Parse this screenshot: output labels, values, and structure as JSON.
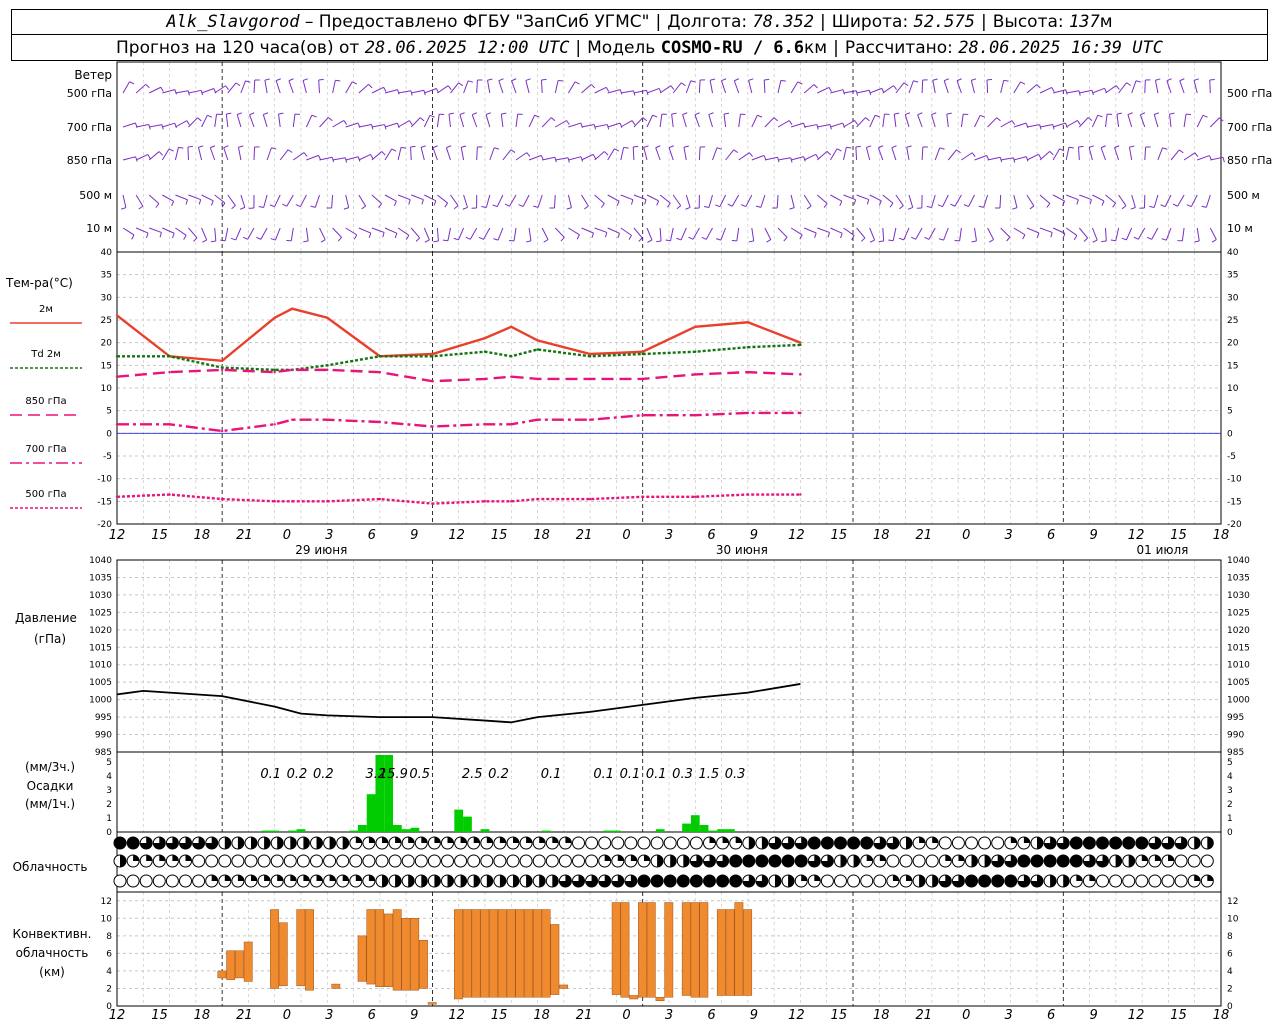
{
  "header": {
    "station": "Alk_Slavgorod",
    "provider_label": "– Предоставлено ФГБУ \"ЗапСиб УГМС\"",
    "lon_label": "Долгота:",
    "lon": "78.352",
    "lat_label": "Широта:",
    "lat": "52.575",
    "alt_label": "Высота:",
    "alt": "137",
    "alt_unit": "м",
    "forecast_label": "Прогноз на 120 часа(ов) от",
    "forecast_start": "28.06.2025 12:00 UTC",
    "model_label": "Модель",
    "model": "COSMO-RU / 6.6",
    "model_unit": "км",
    "computed_label": "Рассчитано:",
    "computed": "28.06.2025 16:39 UTC"
  },
  "panels": {
    "wind": {
      "title": "Ветер",
      "levels": [
        "500 гПа",
        "700 гПа",
        "850 гПа",
        "500 м",
        "10 м"
      ],
      "color": "#7b2fc4"
    },
    "temperature": {
      "title": "Тем-ра(°C)",
      "legend": [
        {
          "label": "2м",
          "color": "#e8402c",
          "style": "solid"
        },
        {
          "label": "Td 2м",
          "color": "#127512",
          "style": "dotted"
        },
        {
          "label": "850 гПа",
          "color": "#e8147c",
          "style": "dashed"
        },
        {
          "label": "700 гПа",
          "color": "#e8147c",
          "style": "dashdot"
        },
        {
          "label": "500 гПа",
          "color": "#e8147c",
          "style": "dotted"
        }
      ],
      "yticks": [
        "40",
        "35",
        "30",
        "25",
        "20",
        "15",
        "10",
        "5",
        "0",
        "-5",
        "-10",
        "-15",
        "-20"
      ]
    },
    "pressure": {
      "title": "Давление",
      "unit": "(гПа)",
      "yticks": [
        "1040",
        "1035",
        "1030",
        "1025",
        "1020",
        "1015",
        "1010",
        "1005",
        "1000",
        "995",
        "990",
        "985"
      ]
    },
    "precip": {
      "unit_top": "(мм/3ч.)",
      "title": "Осадки",
      "unit_bottom": "(мм/1ч.)",
      "yticks": [
        "5",
        "4",
        "3",
        "2",
        "1",
        "0"
      ],
      "color": "#00cc00"
    },
    "clouds": {
      "title": "Облачность"
    },
    "convective": {
      "title_lines": [
        "Конвективн.",
        "облачность",
        "(км)"
      ],
      "yticks": [
        "12",
        "10",
        "8",
        "6",
        "4",
        "2",
        "0"
      ],
      "color": "#ef8a2e"
    }
  },
  "time_axis": {
    "hour_labels": [
      "12",
      "15",
      "18",
      "21",
      "0",
      "3",
      "6",
      "9",
      "12",
      "15",
      "18",
      "21",
      "0",
      "3",
      "6",
      "9",
      "12",
      "15",
      "18",
      "21",
      "0",
      "3",
      "6",
      "9",
      "12",
      "15",
      "18"
    ],
    "date_labels": [
      "29 июня",
      "30 июня",
      "01 июля"
    ]
  },
  "chart_data": [
    {
      "type": "line",
      "title": "Тем-ра(°C)",
      "x": [
        "28.06 12",
        "28.06 18",
        "29.06 00",
        "29.06 06",
        "29.06 08",
        "29.06 12",
        "29.06 18",
        "30.06 00",
        "30.06 06",
        "30.06 09",
        "30.06 12",
        "30.06 18",
        "01.07 00",
        "01.07 06",
        "01.07 12",
        "01.07 18"
      ],
      "series": [
        {
          "name": "2м",
          "values": [
            26,
            17,
            16,
            25.5,
            27.5,
            25.5,
            17,
            17.5,
            21,
            23.5,
            20.5,
            17.5,
            18,
            23.5,
            24.5,
            20
          ]
        },
        {
          "name": "Td 2м",
          "values": [
            17,
            17,
            14.5,
            14,
            14,
            15,
            17,
            17,
            18,
            17,
            18.5,
            17,
            17.5,
            18,
            19,
            19.5
          ]
        },
        {
          "name": "850 гПа",
          "values": [
            12.5,
            13.5,
            14,
            13.5,
            14,
            14,
            13.5,
            11.5,
            12,
            12.5,
            12,
            12,
            12,
            13,
            13.5,
            13
          ]
        },
        {
          "name": "700 гПа",
          "values": [
            2,
            2,
            0.5,
            2,
            3,
            3,
            2.5,
            1.5,
            2,
            2,
            3,
            3,
            4,
            4,
            4.5,
            4.5
          ]
        },
        {
          "name": "500 гПа",
          "values": [
            -14,
            -13.5,
            -14.5,
            -15,
            -15,
            -15,
            -14.5,
            -15.5,
            -15,
            -15,
            -14.5,
            -14.5,
            -14,
            -14,
            -13.5,
            -13.5
          ]
        }
      ],
      "ylim": [
        -20,
        40
      ]
    },
    {
      "type": "line",
      "title": "Давление",
      "ylabel": "(гПа)",
      "x": [
        "28.06 12",
        "28.06 15",
        "28.06 18",
        "29.06 00",
        "29.06 06",
        "29.06 09",
        "29.06 12",
        "29.06 18",
        "30.06 00",
        "30.06 06",
        "30.06 09",
        "30.06 12",
        "30.06 18",
        "01.07 00",
        "01.07 06",
        "01.07 12",
        "01.07 18"
      ],
      "series": [
        {
          "name": "",
          "values": [
            1001.5,
            1002.5,
            1002,
            1001,
            998,
            996,
            995.5,
            995,
            995,
            994,
            993.5,
            995,
            996.5,
            998.5,
            1000.5,
            1002,
            1004.5
          ]
        }
      ],
      "ylim": [
        985,
        1040
      ]
    },
    {
      "type": "bar",
      "title": "Осадки",
      "unit": "мм/1ч.",
      "bars": [
        {
          "t": "29.06 05",
          "v": 0.1
        },
        {
          "t": "29.06 06",
          "v": 0.1
        },
        {
          "t": "29.06 08",
          "v": 0.1
        },
        {
          "t": "29.06 09",
          "v": 0.2
        },
        {
          "t": "29.06 15",
          "v": 0.1
        },
        {
          "t": "29.06 16",
          "v": 0.5
        },
        {
          "t": "29.06 17",
          "v": 2.7
        },
        {
          "t": "29.06 18",
          "v": 5.5
        },
        {
          "t": "29.06 19",
          "v": 5.5
        },
        {
          "t": "29.06 20",
          "v": 0.5
        },
        {
          "t": "29.06 21",
          "v": 0.2
        },
        {
          "t": "29.06 22",
          "v": 0.3
        },
        {
          "t": "30.06 03",
          "v": 1.6
        },
        {
          "t": "30.06 04",
          "v": 1.1
        },
        {
          "t": "30.06 06",
          "v": 0.2
        },
        {
          "t": "30.06 13",
          "v": 0.1
        },
        {
          "t": "30.06 20",
          "v": 0.1
        },
        {
          "t": "30.06 21",
          "v": 0.1
        },
        {
          "t": "01.07 02",
          "v": 0.2
        },
        {
          "t": "01.07 05",
          "v": 0.6
        },
        {
          "t": "01.07 06",
          "v": 1.2
        },
        {
          "t": "01.07 07",
          "v": 0.5
        },
        {
          "t": "01.07 08",
          "v": 0.1
        },
        {
          "t": "01.07 09",
          "v": 0.2
        },
        {
          "t": "01.07 10",
          "v": 0.2
        }
      ],
      "labels_3h": [
        {
          "t": "29.06 06",
          "text": "0.1"
        },
        {
          "t": "29.06 09",
          "text": "0.2"
        },
        {
          "t": "29.06 12",
          "text": "0.2"
        },
        {
          "t": "29.06 18",
          "text": "3.2"
        },
        {
          "t": "29.06 20",
          "text": "15.9"
        },
        {
          "t": "29.06 23",
          "text": "0.5"
        },
        {
          "t": "30.06 05",
          "text": "2.5"
        },
        {
          "t": "30.06 08",
          "text": "0.2"
        },
        {
          "t": "30.06 14",
          "text": "0.1"
        },
        {
          "t": "30.06 20",
          "text": "0.1"
        },
        {
          "t": "30.06 23",
          "text": "0.1"
        },
        {
          "t": "01.07 02",
          "text": "0.1"
        },
        {
          "t": "01.07 05",
          "text": "0.3"
        },
        {
          "t": "01.07 08",
          "text": "1.5"
        },
        {
          "t": "01.07 11",
          "text": "0.3"
        }
      ],
      "ylim": [
        0,
        5
      ]
    },
    {
      "type": "bar",
      "title": "Конвективн. облачность (км)",
      "ylim": [
        0,
        12
      ],
      "bars": [
        {
          "t": "29.06 00",
          "base": 3.2,
          "top": 4.0
        },
        {
          "t": "29.06 01",
          "base": 3.0,
          "top": 6.3
        },
        {
          "t": "29.06 02",
          "base": 3.2,
          "top": 6.3
        },
        {
          "t": "29.06 03",
          "base": 2.8,
          "top": 7.3
        },
        {
          "t": "29.06 06",
          "base": 2.0,
          "top": 11.0
        },
        {
          "t": "29.06 07",
          "base": 2.3,
          "top": 9.5
        },
        {
          "t": "29.06 09",
          "base": 2.3,
          "top": 11.0
        },
        {
          "t": "29.06 10",
          "base": 1.8,
          "top": 11.0
        },
        {
          "t": "29.06 13",
          "base": 2.0,
          "top": 2.5
        },
        {
          "t": "29.06 16",
          "base": 2.8,
          "top": 8.0
        },
        {
          "t": "29.06 17",
          "base": 2.5,
          "top": 11.0
        },
        {
          "t": "29.06 18",
          "base": 2.2,
          "top": 11.0
        },
        {
          "t": "29.06 19",
          "base": 2.2,
          "top": 10.5
        },
        {
          "t": "29.06 20",
          "base": 1.8,
          "top": 11.0
        },
        {
          "t": "29.06 21",
          "base": 1.8,
          "top": 10.0
        },
        {
          "t": "29.06 22",
          "base": 1.8,
          "top": 10.0
        },
        {
          "t": "29.06 23",
          "base": 2.0,
          "top": 7.5
        },
        {
          "t": "30.06 00",
          "base": 0.2,
          "top": 0.4
        },
        {
          "t": "30.06 03",
          "base": 0.8,
          "top": 11.0
        },
        {
          "t": "30.06 04",
          "base": 1.0,
          "top": 11.0
        },
        {
          "t": "30.06 05",
          "base": 1.0,
          "top": 11.0
        },
        {
          "t": "30.06 06",
          "base": 1.0,
          "top": 11.0
        },
        {
          "t": "30.06 07",
          "base": 1.0,
          "top": 11.0
        },
        {
          "t": "30.06 08",
          "base": 1.0,
          "top": 11.0
        },
        {
          "t": "30.06 09",
          "base": 1.0,
          "top": 11.0
        },
        {
          "t": "30.06 10",
          "base": 1.0,
          "top": 11.0
        },
        {
          "t": "30.06 11",
          "base": 1.0,
          "top": 11.0
        },
        {
          "t": "30.06 12",
          "base": 1.0,
          "top": 11.0
        },
        {
          "t": "30.06 13",
          "base": 1.0,
          "top": 11.0
        },
        {
          "t": "30.06 14",
          "base": 1.3,
          "top": 9.3
        },
        {
          "t": "30.06 15",
          "base": 2.0,
          "top": 2.4
        },
        {
          "t": "30.06 21",
          "base": 1.3,
          "top": 11.8
        },
        {
          "t": "30.06 22",
          "base": 1.0,
          "top": 11.8
        },
        {
          "t": "30.06 23",
          "base": 0.8,
          "top": 1.2
        },
        {
          "t": "01.07 00",
          "base": 1.0,
          "top": 11.8
        },
        {
          "t": "01.07 01",
          "base": 1.0,
          "top": 11.8
        },
        {
          "t": "01.07 02",
          "base": 0.6,
          "top": 1.0
        },
        {
          "t": "01.07 03",
          "base": 1.0,
          "top": 11.8
        },
        {
          "t": "01.07 05",
          "base": 1.2,
          "top": 11.8
        },
        {
          "t": "01.07 06",
          "base": 1.0,
          "top": 11.8
        },
        {
          "t": "01.07 07",
          "base": 1.0,
          "top": 11.8
        },
        {
          "t": "01.07 09",
          "base": 1.2,
          "top": 11.0
        },
        {
          "t": "01.07 10",
          "base": 1.2,
          "top": 11.0
        },
        {
          "t": "01.07 11",
          "base": 1.2,
          "top": 11.8
        },
        {
          "t": "01.07 12",
          "base": 1.2,
          "top": 11.0
        }
      ]
    }
  ]
}
